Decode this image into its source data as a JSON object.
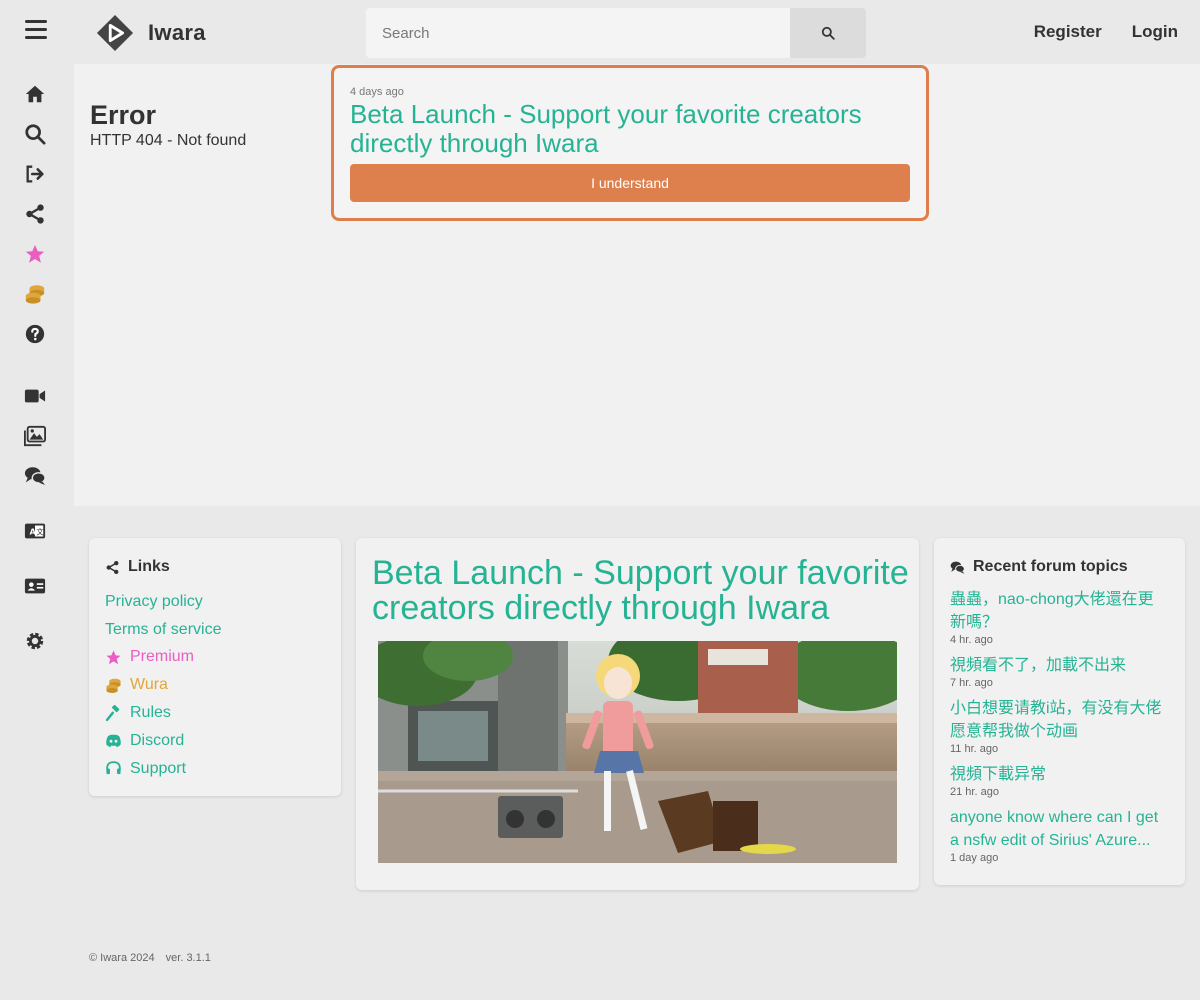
{
  "header": {
    "logo_text": "Iwara",
    "search_placeholder": "Search",
    "register": "Register",
    "login": "Login"
  },
  "sidebar": {
    "items": [
      "home-icon",
      "search-icon",
      "sign-in-icon",
      "share-icon",
      "star-icon",
      "coins-icon",
      "question-icon",
      "video-icon",
      "images-icon",
      "comments-icon",
      "language-icon",
      "id-card-icon",
      "gear-icon"
    ]
  },
  "error": {
    "title": "Error",
    "message": "HTTP 404 - Not found"
  },
  "banner": {
    "time": "4 days ago",
    "title": "Beta Launch - Support your favorite creators directly through Iwara",
    "button": "I understand"
  },
  "links": {
    "heading": "Links",
    "items": [
      {
        "label": "Privacy policy"
      },
      {
        "label": "Terms of service"
      },
      {
        "label": "Premium"
      },
      {
        "label": "Wura"
      },
      {
        "label": "Rules"
      },
      {
        "label": "Discord"
      },
      {
        "label": "Support"
      }
    ]
  },
  "beta": {
    "title": "Beta Launch - Support your favorite creators directly through Iwara"
  },
  "forum": {
    "heading": "Recent forum topics",
    "topics": [
      {
        "title": "蟲蟲，nao-chong大佬還在更新嗎？",
        "time": "4 hr. ago"
      },
      {
        "title": "視頻看不了，加載不出来",
        "time": "7 hr. ago"
      },
      {
        "title": "小白想要请教i站，有没有大佬愿意帮我做个动画",
        "time": "11 hr. ago"
      },
      {
        "title": "視頻下載异常",
        "time": "21 hr. ago"
      },
      {
        "title": "anyone know where can I get a nsfw edit of Sirius' Azure...",
        "time": "1 day ago"
      }
    ]
  },
  "footer": {
    "copyright": "© Iwara 2024",
    "version": "ver. 3.1.1"
  },
  "colors": {
    "accent": "#26b394",
    "orange": "#dd804e",
    "premium": "#e95ec1",
    "wura": "#e0a63a"
  }
}
